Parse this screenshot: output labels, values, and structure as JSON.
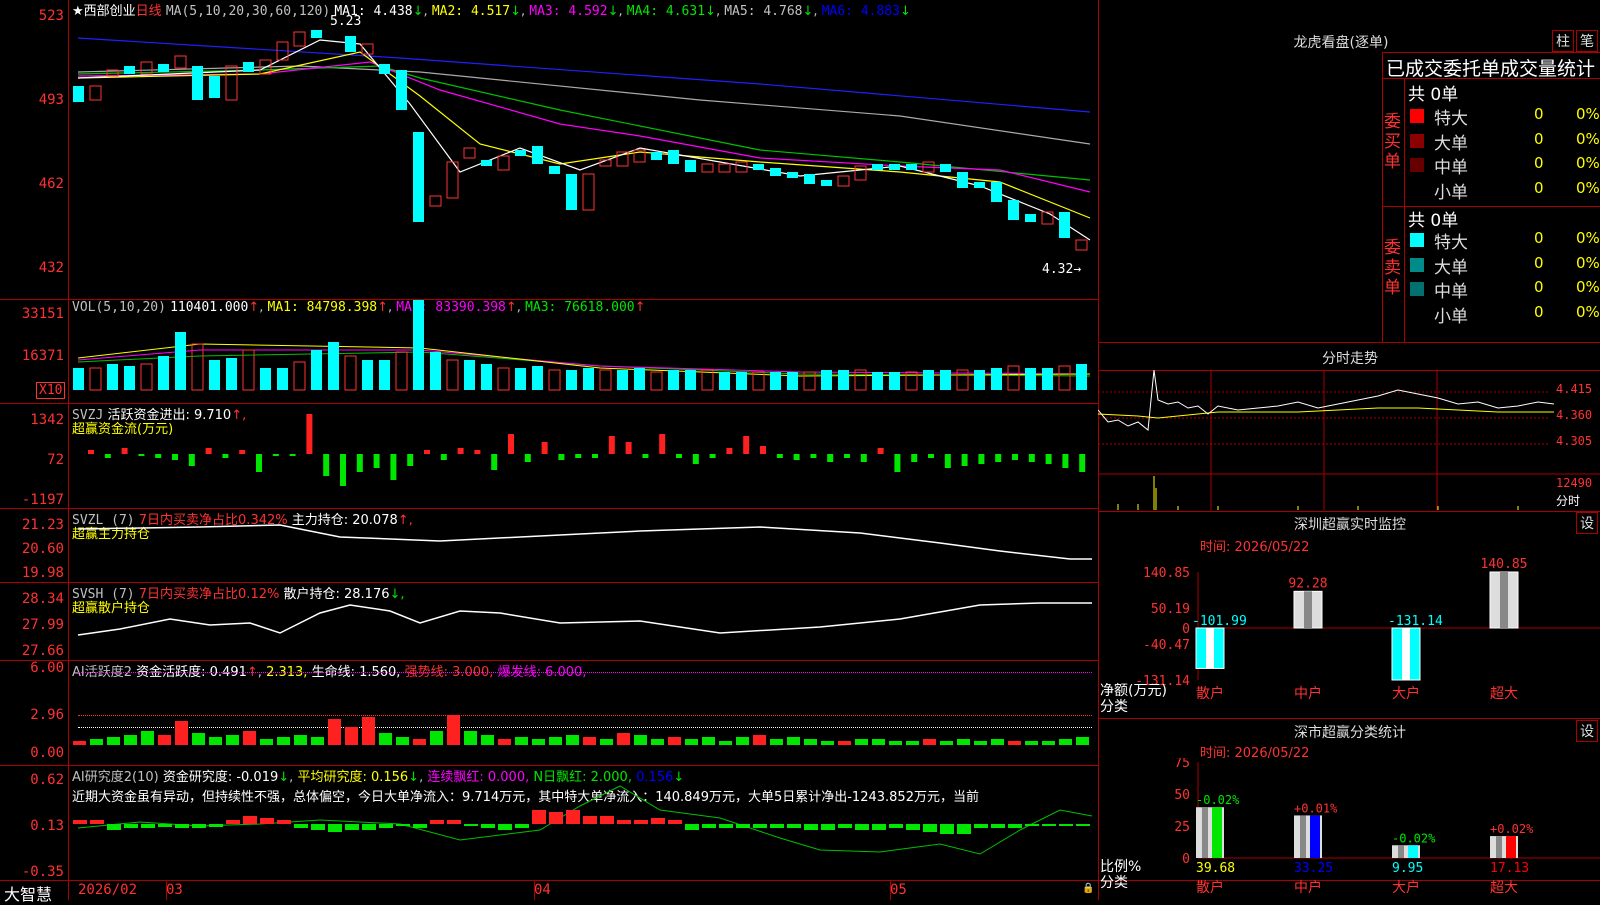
{
  "main": {
    "star": "★",
    "stock": "西部创业",
    "period": "日线",
    "ma_header": "MA(5,10,20,30,60,120)",
    "ma1": "MA1: 4.438",
    "ma2": "MA2: 4.517",
    "ma3": "MA3: 4.592",
    "ma4": "MA4: 4.631",
    "ma5": "MA5: 4.768",
    "ma6": "MA6: 4.883",
    "arrow_down": "↓",
    "arrow_up": "↑",
    "arrow_right": "→",
    "y_labels": [
      "523",
      "493",
      "462",
      "432"
    ],
    "high_label": "5.23",
    "low_label": "4.32"
  },
  "vol": {
    "header": "VOL(5,10,20)",
    "value": "110401.000",
    "ma1": "MA1: 84798.398",
    "ma2": "MA2: 83390.398",
    "ma3": "MA3: 76618.000",
    "y_labels": [
      "33151",
      "16371"
    ],
    "unit": "X10"
  },
  "svzj": {
    "header": "SVZJ",
    "label": "活跃资金进出: 9.710",
    "arrow": "↑,",
    "sub": "超赢资金流(万元)",
    "y_labels": [
      "1342",
      "72",
      "-1197"
    ]
  },
  "svzl": {
    "header": "SVZL (7)",
    "label1": "7日内买卖净占比0.342%",
    "label2": "主力持仓: 20.078",
    "arrow": "↑,",
    "sub": "超赢主力持仓",
    "y_labels": [
      "21.23",
      "20.60",
      "19.98"
    ]
  },
  "svsh": {
    "header": "SVSH (7)",
    "label1": "7日内买卖净占比0.12%",
    "label2": "散户持仓: 28.176",
    "arrow": "↓,",
    "sub": "超赢散户持仓",
    "y_labels": [
      "28.34",
      "27.99",
      "27.66"
    ]
  },
  "ai_act": {
    "header": "AI活跃度2",
    "label": "资金活跃度: 0.491",
    "val2": "2.313,",
    "life": "生命线: 1.560,",
    "strong": "强势线: 3.000,",
    "burst": "爆发线: 6.000,",
    "y_labels": [
      "6.00",
      "2.96",
      "0.00"
    ]
  },
  "ai_res": {
    "header": "AI研究度2(10)",
    "label": "资金研究度: -0.019",
    "avg": "平均研究度: 0.156",
    "cont": "连续飘红: 0.000,",
    "nday": "N日飘红: 2.000,",
    "last": "0.156",
    "text": "近期大资金虽有异动，但持续性不强，总体偏空，今日大单净流入：9.714万元，其中特大单净流入：140.849万元，大单5日累计净出-1243.852万元，当前",
    "y_labels": [
      "0.62",
      "0.13",
      "-0.35"
    ]
  },
  "bottom": {
    "brand": "大智慧",
    "dates": [
      "2026/02",
      "03",
      "04",
      "05"
    ]
  },
  "right": {
    "title": "龙虎看盘(逐单)",
    "btn1": "柱",
    "btn2": "笔",
    "stats_title": "已成交委托单成交量统计",
    "buy_label": "委买单",
    "sell_label": "委卖单",
    "buy_total": "共 0单",
    "sell_total": "共 0单",
    "buy_rows": [
      {
        "label": "特大",
        "count": "0",
        "pct": "0%",
        "color": "#ff0000"
      },
      {
        "label": "大单",
        "count": "0",
        "pct": "0%",
        "color": "#8b0000"
      },
      {
        "label": "中单",
        "count": "0",
        "pct": "0%",
        "color": "#660000"
      },
      {
        "label": "小单",
        "count": "0",
        "pct": "0%",
        "color": "#000000"
      }
    ],
    "sell_rows": [
      {
        "label": "特大",
        "count": "0",
        "pct": "0%",
        "color": "#00ffff"
      },
      {
        "label": "大单",
        "count": "0",
        "pct": "0%",
        "color": "#008b8b"
      },
      {
        "label": "中单",
        "count": "0",
        "pct": "0%",
        "color": "#007070"
      },
      {
        "label": "小单",
        "count": "0",
        "pct": "0%",
        "color": "#000000"
      }
    ],
    "intraday_title": "分时走势",
    "intraday_prices": [
      "4.415",
      "4.360",
      "4.305"
    ],
    "intraday_vol": "12490",
    "intraday_unit": "分时",
    "sz_title": "深圳超赢实时监控",
    "sz_settings": "设",
    "sz_time": "时间: 2026/05/22",
    "sz_axis": [
      "140.85",
      "50.19",
      "0",
      "-40.47",
      "-131.14"
    ],
    "sz_net_label": "净额(万元)",
    "sz_cat_label": "分类",
    "sz_bars": [
      {
        "cat": "散户",
        "value": -101.99,
        "label": "-101.99"
      },
      {
        "cat": "中户",
        "value": 92.28,
        "label": "92.28"
      },
      {
        "cat": "大户",
        "value": -131.14,
        "label": "-131.14"
      },
      {
        "cat": "超大",
        "value": 140.85,
        "label": "140.85"
      }
    ],
    "sc_title": "深市超赢分类统计",
    "sc_settings": "设",
    "sc_time": "时间: 2026/05/22",
    "sc_axis": [
      "75",
      "50",
      "25",
      "0"
    ],
    "sc_ratio_label": "比例%",
    "sc_cat_label": "分类",
    "sc_bars": [
      {
        "cat": "散户",
        "value": 39.68,
        "label": "39.68",
        "delta": "-0.02%",
        "color": "#00e600"
      },
      {
        "cat": "中户",
        "value": 33.25,
        "label": "33.25",
        "delta": "+0.01%",
        "color": "#0000ff"
      },
      {
        "cat": "大户",
        "value": 9.95,
        "label": "9.95",
        "delta": "-0.02%",
        "color": "#00ffff"
      },
      {
        "cat": "超大",
        "value": 17.13,
        "label": "17.13",
        "delta": "+0.02%",
        "color": "#ff0000"
      }
    ]
  }
}
